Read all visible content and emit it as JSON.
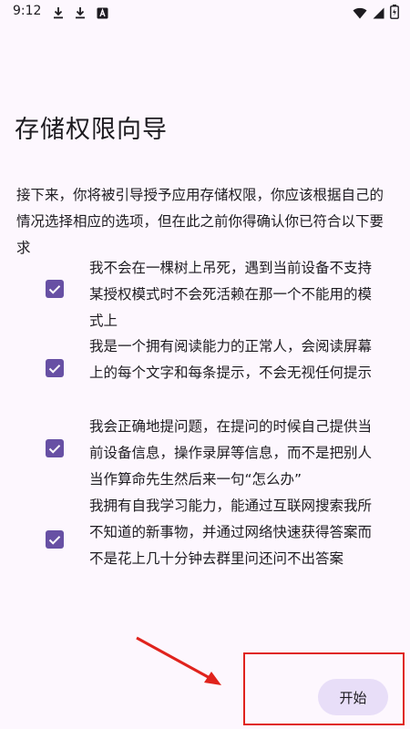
{
  "status_bar": {
    "time": "9:12",
    "left_icons": [
      "download-icon",
      "download-icon",
      "a-box-icon"
    ],
    "right_icons": [
      "wifi-icon",
      "signal-icon",
      "battery-charging-icon"
    ]
  },
  "title": "存储权限向导",
  "intro": "接下来，你将被引导授予应用存储权限，你应该根据自己的情况选择相应的选项，但在此之前你得确认你已符合以下要求",
  "requirements": [
    {
      "text": "我不会在一棵树上吊死，遇到当前设备不支持某授权模式时不会死活赖在那一个不能用的模式上",
      "checked": true
    },
    {
      "text": "我是一个拥有阅读能力的正常人，会阅读屏幕上的每个文字和每条提示，不会无视任何提示",
      "checked": true
    },
    {
      "text": "我会正确地提问题，在提问的时候自己提供当前设备信息，操作录屏等信息，而不是把别人当作算命先生然后来一句“怎么办”",
      "checked": true
    },
    {
      "text": "我拥有自我学习能力，能通过互联网搜索我所不知道的新事物，并通过网络快速获得答案而不是花上几十分钟去群里问还问不出答案",
      "checked": true
    }
  ],
  "start_button": "开始",
  "colors": {
    "background": "#fdf7fe",
    "checkbox": "#6750a4",
    "button_bg": "#e8def8",
    "annotation_red": "#e0231d"
  }
}
